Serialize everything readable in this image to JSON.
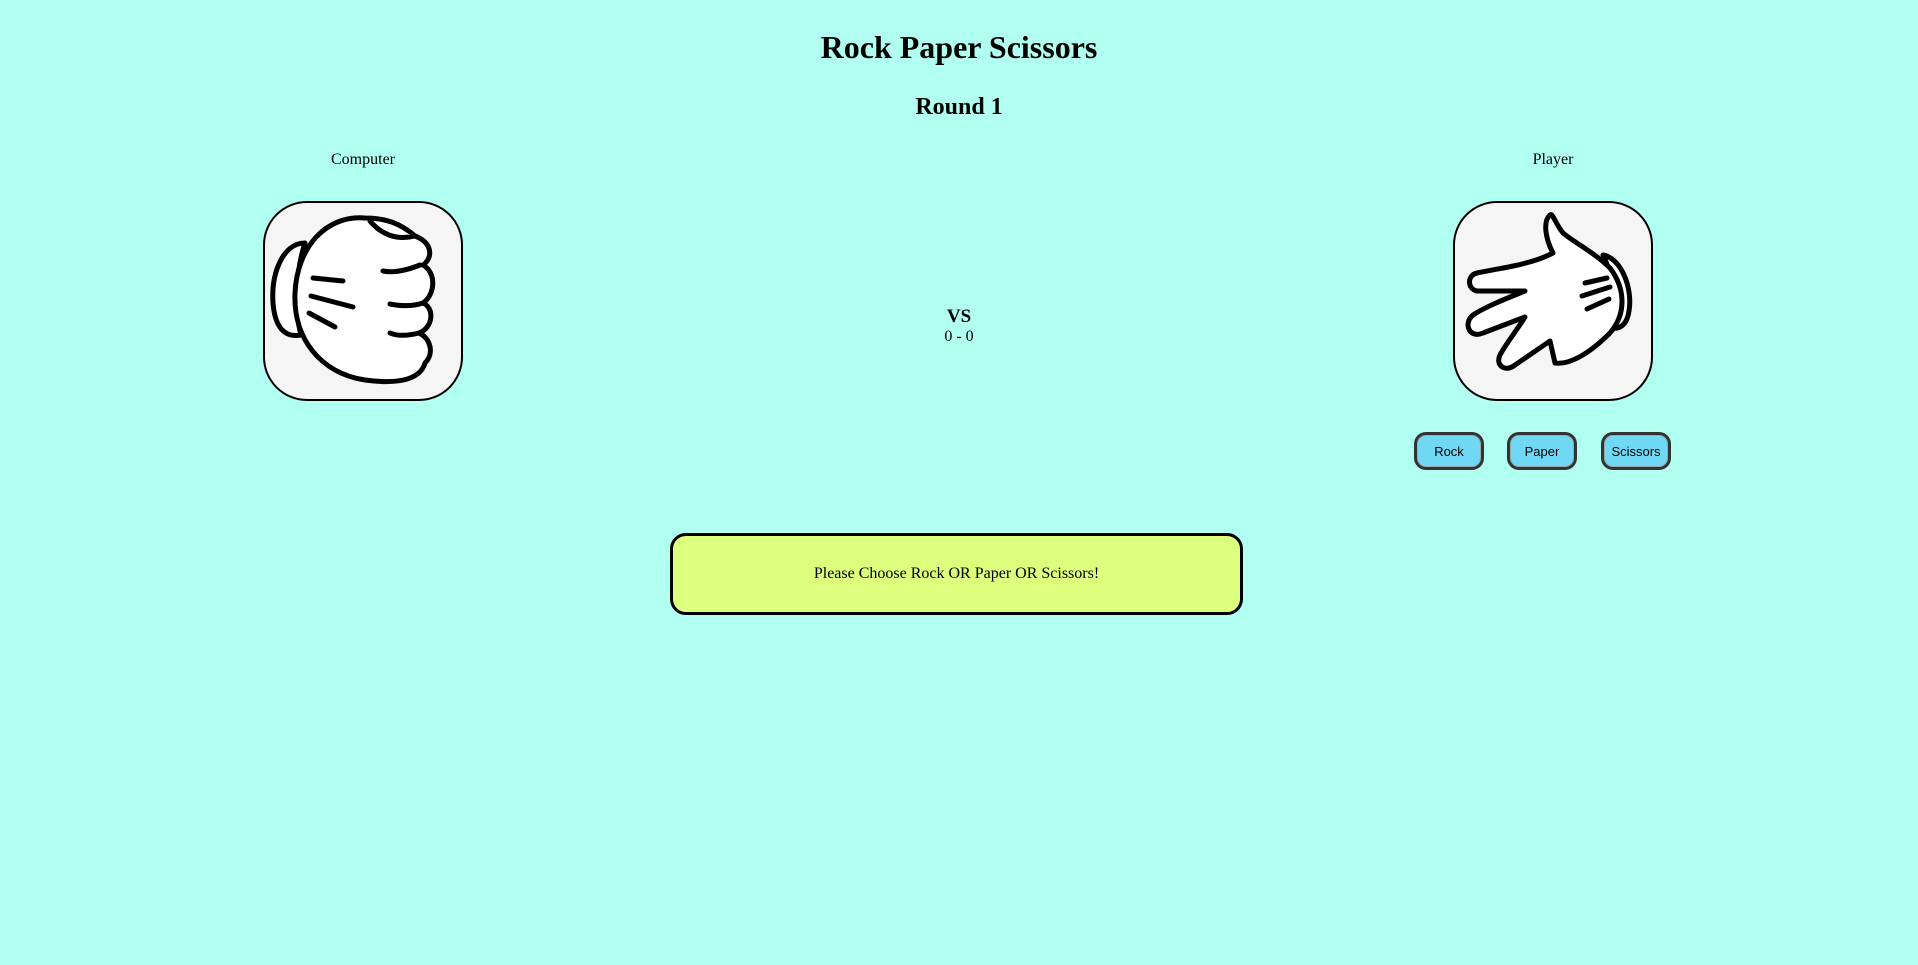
{
  "header": {
    "title": "Rock Paper Scissors",
    "round": "Round 1"
  },
  "computer": {
    "label": "Computer",
    "hand": "rock-hand-icon"
  },
  "player": {
    "label": "Player",
    "hand": "paper-hand-icon"
  },
  "center": {
    "vs": "VS",
    "score": "0 - 0"
  },
  "choices": {
    "rock": "Rock",
    "paper": "Paper",
    "scissors": "Scissors"
  },
  "message": "Please Choose Rock OR Paper OR Scissors!",
  "colors": {
    "background": "#b0fff0",
    "button": "#6fd8f4",
    "message_box": "#dcff7e",
    "hand_box": "#f5f5f5"
  }
}
